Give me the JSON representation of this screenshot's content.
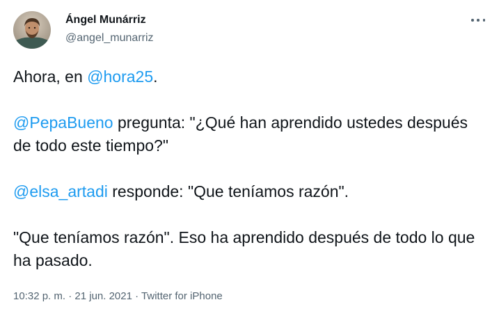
{
  "user": {
    "display_name": "Ángel Munárriz",
    "handle": "@angel_munarriz"
  },
  "tweet": {
    "p1": {
      "t1": "Ahora, en ",
      "m1": "@hora25",
      "t2": "."
    },
    "p2": {
      "m1": "@PepaBueno",
      "t1": " pregunta: \"¿Qué han aprendido ustedes después de todo este tiempo?\""
    },
    "p3": {
      "m1": "@elsa_artadi",
      "t1": " responde: \"Que teníamos razón\"."
    },
    "p4": {
      "t1": "\"Que teníamos razón\". Eso ha aprendido después de todo lo que ha pasado."
    }
  },
  "meta": {
    "time": "10:32 p. m.",
    "sep1": " · ",
    "date": "21 jun. 2021",
    "sep2": " · ",
    "source": "Twitter for iPhone"
  },
  "icons": {
    "more": "more-horizontal-icon"
  },
  "colors": {
    "mention": "#1d9bf0",
    "secondary": "#536471",
    "text": "#0f1419"
  }
}
